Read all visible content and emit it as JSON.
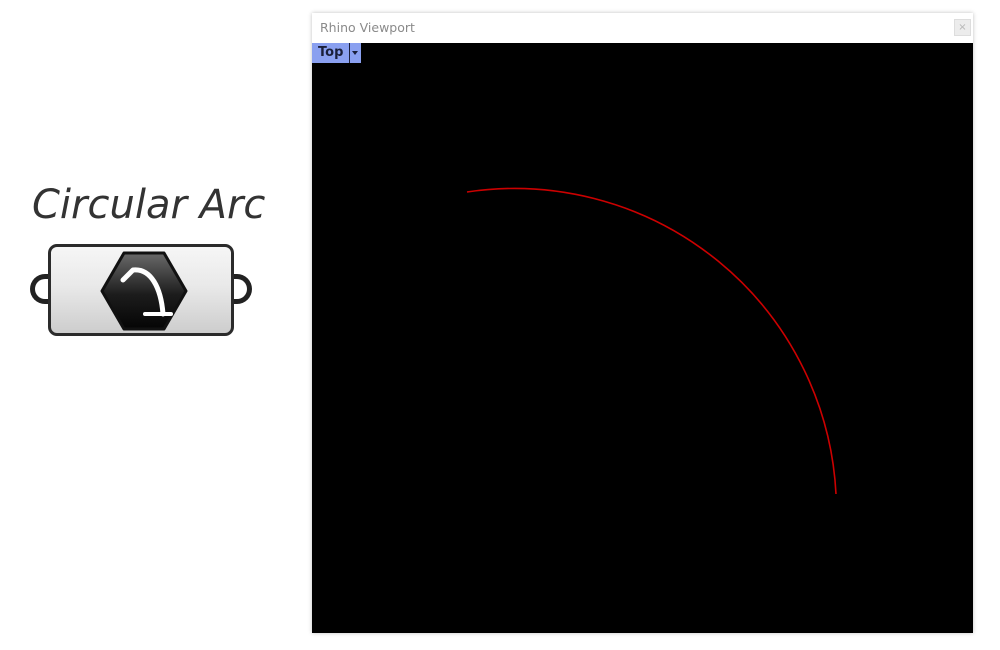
{
  "component": {
    "title": "Circular Arc",
    "icon": "arc-hexagon-icon"
  },
  "viewport": {
    "window_title": "Rhino Viewport",
    "close_glyph": "×",
    "view_name": "Top",
    "dropdown_icon": "chevron-down-icon",
    "background_color": "#000000",
    "tab_color": "#8aa0f0",
    "arc": {
      "color": "#cc0000",
      "sweep_degrees": 100
    }
  }
}
